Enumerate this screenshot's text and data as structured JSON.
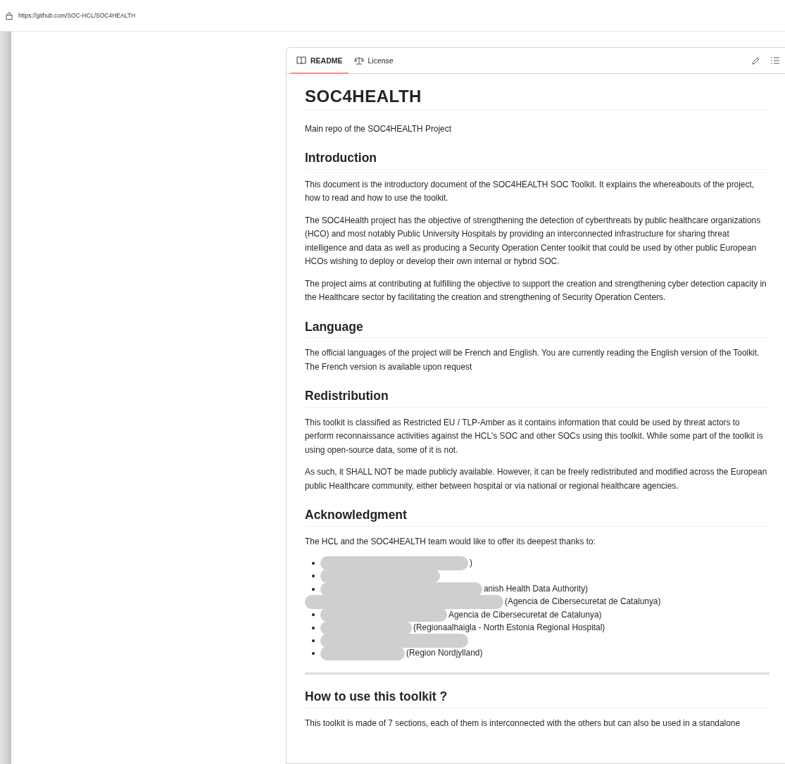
{
  "address_bar": {
    "url": "https://github.com/SOC-HCL/SOC4HEALTH"
  },
  "tabs": [
    {
      "label": "README",
      "selected": true
    },
    {
      "label": "License",
      "selected": false
    }
  ],
  "readme": {
    "title": "SOC4HEALTH",
    "blocks": [
      {
        "kind": "p",
        "text": "Main repo of the SOC4HEALTH Project"
      },
      {
        "kind": "h2",
        "text": "Introduction"
      },
      {
        "kind": "p",
        "text": "This document is the introductory document of the SOC4HEALTH SOC Toolkit. It explains the whereabouts of the project, how to read and how to use the toolkit."
      },
      {
        "kind": "p",
        "text": "The SOC4Health project has the objective of strengthening the detection of cyberthreats by public healthcare organizations (HCO) and most notably Public University Hospitals by providing an interconnected infrastructure for sharing threat intelligence and data as well as producing a Security Operation Center toolkit that could be used by other public European HCOs wishing to deploy or develop their own internal or hybrid SOC."
      },
      {
        "kind": "p",
        "text": "The project aims at contributing at fulfilling the objective to support the creation and strengthening cyber detection capacity in the Healthcare sector by facilitating the creation and strengthening of Security Operation Centers."
      },
      {
        "kind": "h2",
        "text": "Language"
      },
      {
        "kind": "p",
        "text": "The official languages of the project will be French and English. You are currently reading the English version of the Toolkit. The French version is available upon request"
      },
      {
        "kind": "h2",
        "text": "Redistribution"
      },
      {
        "kind": "p",
        "text": "This toolkit is classified as Restricted EU / TLP-Amber as it contains information that could be used by threat actors to perform reconnaissance activities against the HCL's SOC and other SOCs using this toolkit. While some part of the toolkit is using open-source data, some of it is not."
      },
      {
        "kind": "p",
        "text": "As such, it SHALL NOT be made publicly available. However, it can be freely redistributed and modified across the European public Healthcare community, either between hospital or via national or regional healthcare agencies."
      },
      {
        "kind": "h2",
        "text": "Acknowledgment"
      },
      {
        "kind": "p",
        "text": "The HCL and the SOC4HEALTH team would like to offer its deepest thanks to:"
      },
      {
        "kind": "list",
        "items": [
          {
            "text": ")",
            "covers_bullet": false
          },
          {
            "covers_bullet": false
          },
          {
            "text": "anish Health Data Authority)",
            "covers_bullet": false
          },
          {
            "text": "(Agencia de Cibersecuretat de Catalunya)",
            "covers_bullet": true
          },
          {
            "text": "Agencia de Cibersecuretat de Catalunya)",
            "covers_bullet": false
          },
          {
            "text": "(Regionaalhaigla - North Estonia Regional Hospital)",
            "covers_bullet": false
          },
          {
            "covers_bullet": false
          },
          {
            "text": "(Region Nordjylland)",
            "covers_bullet": false
          }
        ]
      },
      {
        "kind": "hr"
      },
      {
        "kind": "h2",
        "text": "How to use this toolkit ?"
      },
      {
        "kind": "p",
        "text": "This toolkit is made of 7 sections, each of them is interconnected with the others but can also be used in a standalone"
      }
    ]
  }
}
